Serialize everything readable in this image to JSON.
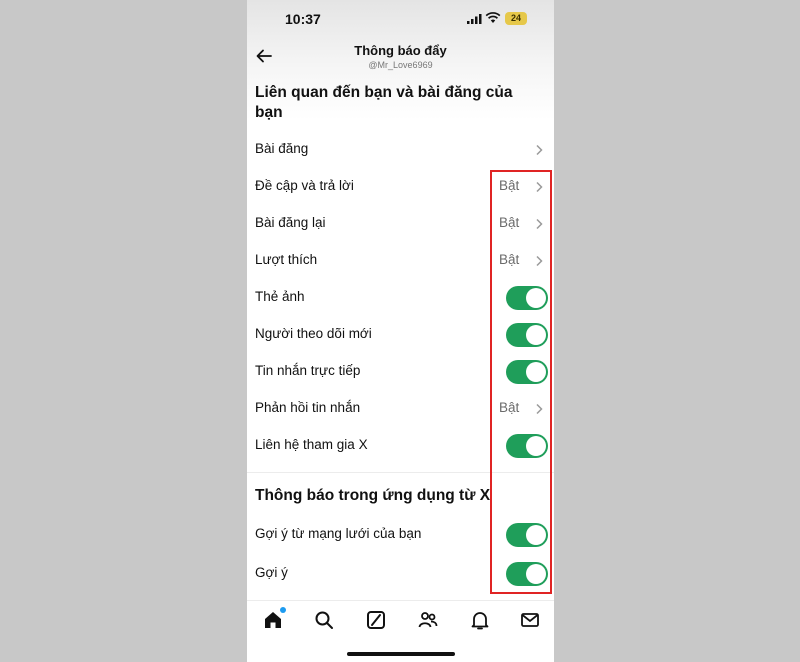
{
  "status_bar": {
    "time": "10:37",
    "battery": "24"
  },
  "header": {
    "title": "Thông báo đẩy",
    "subtitle": "@Mr_Love6969"
  },
  "section1": {
    "title": "Liên quan đến bạn và bài đăng của bạn"
  },
  "rows": [
    {
      "label": "Bài đăng",
      "type": "link",
      "value": ""
    },
    {
      "label": "Đề cập và trả lời",
      "type": "link",
      "value": "Bật"
    },
    {
      "label": "Bài đăng lại",
      "type": "link",
      "value": "Bật"
    },
    {
      "label": "Lượt thích",
      "type": "link",
      "value": "Bật"
    },
    {
      "label": "Thẻ ảnh",
      "type": "toggle",
      "on": true
    },
    {
      "label": "Người theo dõi mới",
      "type": "toggle",
      "on": true
    },
    {
      "label": "Tin nhắn trực tiếp",
      "type": "toggle",
      "on": true
    },
    {
      "label": "Phản hồi tin nhắn",
      "type": "link",
      "value": "Bật"
    },
    {
      "label": "Liên hệ tham gia X",
      "type": "toggle",
      "on": true
    }
  ],
  "section2": {
    "title": "Thông báo trong ứng dụng từ X"
  },
  "rows2": [
    {
      "label": "Gợi ý từ mạng lưới của bạn",
      "type": "toggle",
      "on": true
    },
    {
      "label": "Gợi ý",
      "type": "toggle",
      "on": true
    }
  ],
  "tabbar": [
    "home-icon",
    "search-icon",
    "grok-icon",
    "communities-icon",
    "notifications-icon",
    "messages-icon"
  ],
  "colors": {
    "toggle_on": "#1f9e5a",
    "highlight": "#e02424",
    "notification_dot": "#1d9bf0"
  }
}
